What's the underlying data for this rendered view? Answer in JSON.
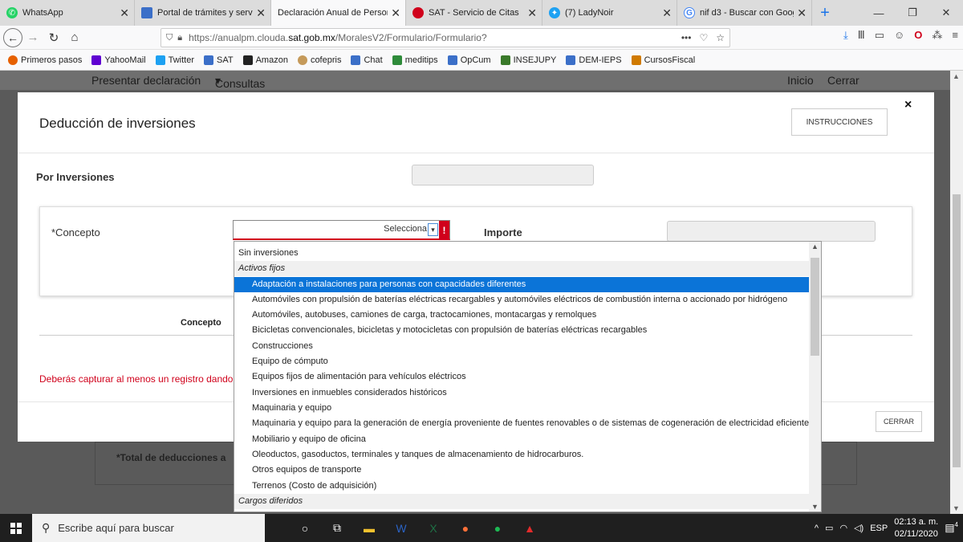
{
  "browser": {
    "tabs": [
      {
        "label": "WhatsApp",
        "icon": "whatsapp-icon",
        "color": "#25d366",
        "active": false
      },
      {
        "label": "Portal de trámites y servi",
        "icon": "portal-icon",
        "color": "#3b6fc8",
        "active": false
      },
      {
        "label": "Declaración Anual de Person",
        "icon": "",
        "color": "",
        "active": true
      },
      {
        "label": "SAT - Servicio de Citas",
        "icon": "sat-icon",
        "color": "#d0011b",
        "active": false
      },
      {
        "label": "(7) LadyNoir",
        "icon": "twitter-icon",
        "color": "#1da1f2",
        "active": false
      },
      {
        "label": "nif d3 - Buscar con Goog",
        "icon": "google-icon",
        "color": "#4285f4",
        "active": false
      }
    ],
    "url_prefix": "https://anualpm.clouda.",
    "url_domain": "sat.gob.mx",
    "url_suffix": "/MoralesV2/Formulario/Formulario?",
    "bookmarks": [
      {
        "label": "Primeros pasos",
        "color": "#e66000"
      },
      {
        "label": "YahooMail",
        "color": "#5f01d1"
      },
      {
        "label": "Twitter",
        "color": "#1da1f2"
      },
      {
        "label": "SAT",
        "color": "#3b6fc8"
      },
      {
        "label": "Amazon",
        "color": "#222222"
      },
      {
        "label": "cofepris",
        "color": "#c59a5a"
      },
      {
        "label": "Chat",
        "color": "#3b6fc8"
      },
      {
        "label": "meditips",
        "color": "#2e8b3a"
      },
      {
        "label": "OpCum",
        "color": "#3b6fc8"
      },
      {
        "label": "INSEJUPY",
        "color": "#3a7a2a"
      },
      {
        "label": "DEM-IEPS",
        "color": "#3b6fc8"
      },
      {
        "label": "CursosFiscal",
        "color": "#d07a00"
      }
    ]
  },
  "site_nav": {
    "presentar": "Presentar declaración",
    "consultas": "Consultas",
    "inicio": "Inicio",
    "cerrar": "Cerrar"
  },
  "page_behind": {
    "total_label": "*Total de deducciones a"
  },
  "modal": {
    "title": "Deducción de inversiones",
    "instrucciones": "INSTRUCCIONES",
    "close": "×",
    "por_inversiones": "Por Inversiones",
    "concepto_label": "*Concepto",
    "select_value": "Selecciona",
    "importe_label": "Importe",
    "table_concepto": "Concepto",
    "warning": "Deberás capturar al menos un registro dando",
    "cerrar": "CERRAR"
  },
  "dropdown": {
    "items": [
      {
        "label": "Sin inversiones",
        "type": "plain"
      },
      {
        "label": "Activos fijos",
        "type": "group"
      },
      {
        "label": "Adaptación a instalaciones para personas con capacidades diferentes",
        "type": "option",
        "highlighted": true
      },
      {
        "label": "Automóviles con propulsión de baterías eléctricas recargables y automóviles eléctricos de combustión interna o accionado por hidrógeno",
        "type": "option"
      },
      {
        "label": "Automóviles, autobuses, camiones de carga, tractocamiones, montacargas y remolques",
        "type": "option"
      },
      {
        "label": "Bicicletas convencionales, bicicletas y motocicletas con propulsión de baterías eléctricas recargables",
        "type": "option"
      },
      {
        "label": "Construcciones",
        "type": "option"
      },
      {
        "label": "Equipo de cómputo",
        "type": "option"
      },
      {
        "label": "Equipos fijos de alimentación para vehículos eléctricos",
        "type": "option"
      },
      {
        "label": "Inversiones en inmuebles considerados históricos",
        "type": "option"
      },
      {
        "label": "Maquinaria y equipo",
        "type": "option"
      },
      {
        "label": "Maquinaria y equipo para la generación de energía proveniente de fuentes renovables o de sistemas de cogeneración de electricidad eficiente.",
        "type": "option"
      },
      {
        "label": "Mobiliario y equipo de oficina",
        "type": "option"
      },
      {
        "label": "Oleoductos, gasoductos, terminales y tanques de almacenamiento de hidrocarburos.",
        "type": "option"
      },
      {
        "label": "Otros equipos de transporte",
        "type": "option"
      },
      {
        "label": "Terrenos (Costo de adquisición)",
        "type": "option"
      },
      {
        "label": "Cargos diferidos",
        "type": "group"
      }
    ]
  },
  "taskbar": {
    "search_placeholder": "Escribe aquí para buscar",
    "language": "ESP",
    "time": "02:13 a. m.",
    "date": "02/11/2020",
    "notifications": "4"
  },
  "colors": {
    "accent": "#0b74d8",
    "error": "#d0011b"
  }
}
